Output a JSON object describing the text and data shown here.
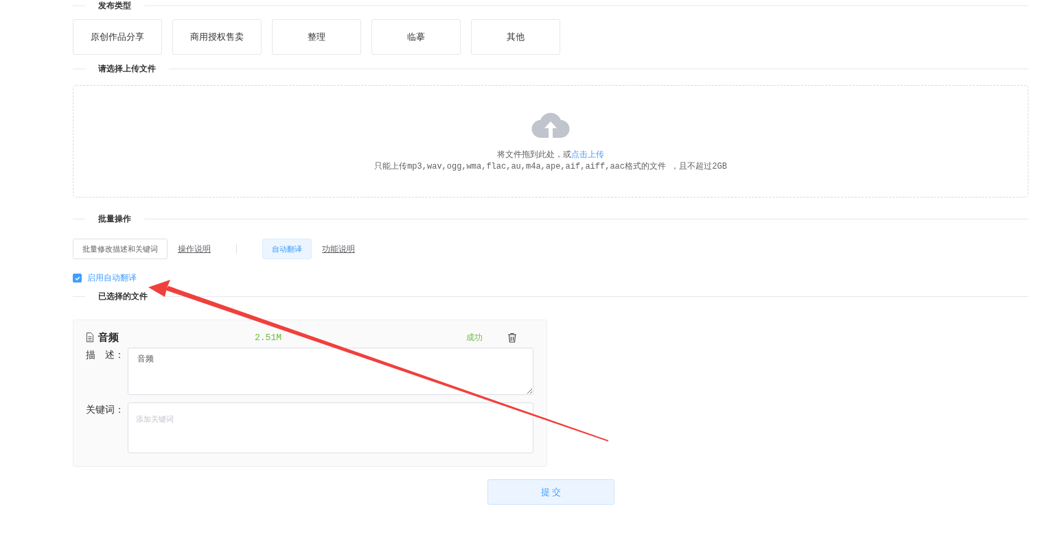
{
  "publish_type": {
    "heading": "发布类型",
    "options": [
      {
        "label": "原创作品分享",
        "selected": false
      },
      {
        "label": "商用授权售卖",
        "selected": false
      },
      {
        "label": "整理",
        "selected": false
      },
      {
        "label": "临摹",
        "selected": false
      },
      {
        "label": "其他",
        "selected": false
      }
    ]
  },
  "upload": {
    "heading": "请选择上传文件",
    "prompt": "将文件拖到此处，或",
    "link": "点击上传",
    "hint": "只能上传mp3,wav,ogg,wma,flac,au,m4a,ape,aif,aiff,aac格式的文件 ，且不超过2GB"
  },
  "batch": {
    "heading": "批量操作",
    "actions": [
      {
        "label": "批量修改描述和关键词",
        "kind": "button"
      },
      {
        "label": "操作说明",
        "kind": "link"
      },
      {
        "kind": "divider"
      },
      {
        "label": "自动翻译",
        "kind": "light-button"
      },
      {
        "label": "功能说明",
        "kind": "link"
      }
    ],
    "auto_translate": {
      "label": "启用自动翻译",
      "checked": true
    }
  },
  "files": {
    "heading": "已选择的文件",
    "items": [
      {
        "name": "音频",
        "size": "2.51M",
        "status": "成功",
        "description_label": "描　述：",
        "description": "音频",
        "keywords_label": "关键词：",
        "keywords_placeholder": "添加关键词"
      }
    ]
  },
  "submit": "提 交"
}
